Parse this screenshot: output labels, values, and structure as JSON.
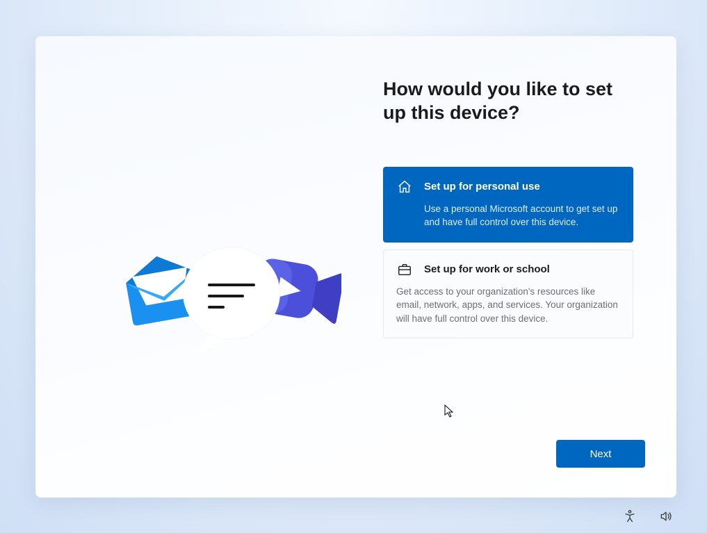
{
  "page": {
    "heading": "How would you like to set up this device?"
  },
  "options": {
    "personal": {
      "title": "Set up for personal use",
      "description": "Use a personal Microsoft account to get set up and have full control over this device."
    },
    "work": {
      "title": "Set up for work or school",
      "description": "Get access to your organization's resources like email, network, apps, and services. Your organization will have full control over this device."
    }
  },
  "buttons": {
    "next": "Next"
  },
  "icons": {
    "home": "home-icon",
    "briefcase": "briefcase-icon",
    "accessibility": "accessibility-icon",
    "volume": "volume-icon"
  }
}
